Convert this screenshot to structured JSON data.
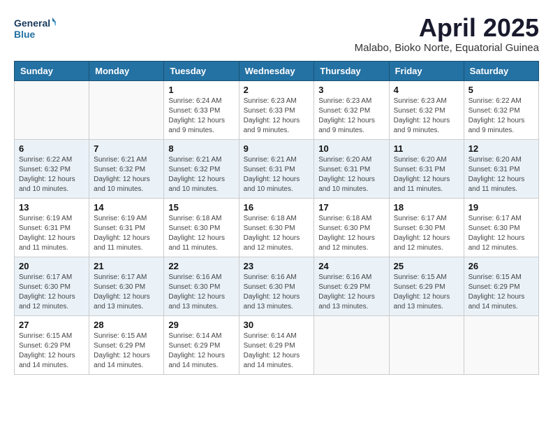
{
  "header": {
    "logo_line1": "General",
    "logo_line2": "Blue",
    "month_title": "April 2025",
    "subtitle": "Malabo, Bioko Norte, Equatorial Guinea"
  },
  "weekdays": [
    "Sunday",
    "Monday",
    "Tuesday",
    "Wednesday",
    "Thursday",
    "Friday",
    "Saturday"
  ],
  "weeks": [
    [
      {
        "day": "",
        "info": ""
      },
      {
        "day": "",
        "info": ""
      },
      {
        "day": "1",
        "info": "Sunrise: 6:24 AM\nSunset: 6:33 PM\nDaylight: 12 hours and 9 minutes."
      },
      {
        "day": "2",
        "info": "Sunrise: 6:23 AM\nSunset: 6:33 PM\nDaylight: 12 hours and 9 minutes."
      },
      {
        "day": "3",
        "info": "Sunrise: 6:23 AM\nSunset: 6:32 PM\nDaylight: 12 hours and 9 minutes."
      },
      {
        "day": "4",
        "info": "Sunrise: 6:23 AM\nSunset: 6:32 PM\nDaylight: 12 hours and 9 minutes."
      },
      {
        "day": "5",
        "info": "Sunrise: 6:22 AM\nSunset: 6:32 PM\nDaylight: 12 hours and 9 minutes."
      }
    ],
    [
      {
        "day": "6",
        "info": "Sunrise: 6:22 AM\nSunset: 6:32 PM\nDaylight: 12 hours and 10 minutes."
      },
      {
        "day": "7",
        "info": "Sunrise: 6:21 AM\nSunset: 6:32 PM\nDaylight: 12 hours and 10 minutes."
      },
      {
        "day": "8",
        "info": "Sunrise: 6:21 AM\nSunset: 6:32 PM\nDaylight: 12 hours and 10 minutes."
      },
      {
        "day": "9",
        "info": "Sunrise: 6:21 AM\nSunset: 6:31 PM\nDaylight: 12 hours and 10 minutes."
      },
      {
        "day": "10",
        "info": "Sunrise: 6:20 AM\nSunset: 6:31 PM\nDaylight: 12 hours and 10 minutes."
      },
      {
        "day": "11",
        "info": "Sunrise: 6:20 AM\nSunset: 6:31 PM\nDaylight: 12 hours and 11 minutes."
      },
      {
        "day": "12",
        "info": "Sunrise: 6:20 AM\nSunset: 6:31 PM\nDaylight: 12 hours and 11 minutes."
      }
    ],
    [
      {
        "day": "13",
        "info": "Sunrise: 6:19 AM\nSunset: 6:31 PM\nDaylight: 12 hours and 11 minutes."
      },
      {
        "day": "14",
        "info": "Sunrise: 6:19 AM\nSunset: 6:31 PM\nDaylight: 12 hours and 11 minutes."
      },
      {
        "day": "15",
        "info": "Sunrise: 6:18 AM\nSunset: 6:30 PM\nDaylight: 12 hours and 11 minutes."
      },
      {
        "day": "16",
        "info": "Sunrise: 6:18 AM\nSunset: 6:30 PM\nDaylight: 12 hours and 12 minutes."
      },
      {
        "day": "17",
        "info": "Sunrise: 6:18 AM\nSunset: 6:30 PM\nDaylight: 12 hours and 12 minutes."
      },
      {
        "day": "18",
        "info": "Sunrise: 6:17 AM\nSunset: 6:30 PM\nDaylight: 12 hours and 12 minutes."
      },
      {
        "day": "19",
        "info": "Sunrise: 6:17 AM\nSunset: 6:30 PM\nDaylight: 12 hours and 12 minutes."
      }
    ],
    [
      {
        "day": "20",
        "info": "Sunrise: 6:17 AM\nSunset: 6:30 PM\nDaylight: 12 hours and 12 minutes."
      },
      {
        "day": "21",
        "info": "Sunrise: 6:17 AM\nSunset: 6:30 PM\nDaylight: 12 hours and 13 minutes."
      },
      {
        "day": "22",
        "info": "Sunrise: 6:16 AM\nSunset: 6:30 PM\nDaylight: 12 hours and 13 minutes."
      },
      {
        "day": "23",
        "info": "Sunrise: 6:16 AM\nSunset: 6:30 PM\nDaylight: 12 hours and 13 minutes."
      },
      {
        "day": "24",
        "info": "Sunrise: 6:16 AM\nSunset: 6:29 PM\nDaylight: 12 hours and 13 minutes."
      },
      {
        "day": "25",
        "info": "Sunrise: 6:15 AM\nSunset: 6:29 PM\nDaylight: 12 hours and 13 minutes."
      },
      {
        "day": "26",
        "info": "Sunrise: 6:15 AM\nSunset: 6:29 PM\nDaylight: 12 hours and 14 minutes."
      }
    ],
    [
      {
        "day": "27",
        "info": "Sunrise: 6:15 AM\nSunset: 6:29 PM\nDaylight: 12 hours and 14 minutes."
      },
      {
        "day": "28",
        "info": "Sunrise: 6:15 AM\nSunset: 6:29 PM\nDaylight: 12 hours and 14 minutes."
      },
      {
        "day": "29",
        "info": "Sunrise: 6:14 AM\nSunset: 6:29 PM\nDaylight: 12 hours and 14 minutes."
      },
      {
        "day": "30",
        "info": "Sunrise: 6:14 AM\nSunset: 6:29 PM\nDaylight: 12 hours and 14 minutes."
      },
      {
        "day": "",
        "info": ""
      },
      {
        "day": "",
        "info": ""
      },
      {
        "day": "",
        "info": ""
      }
    ]
  ]
}
